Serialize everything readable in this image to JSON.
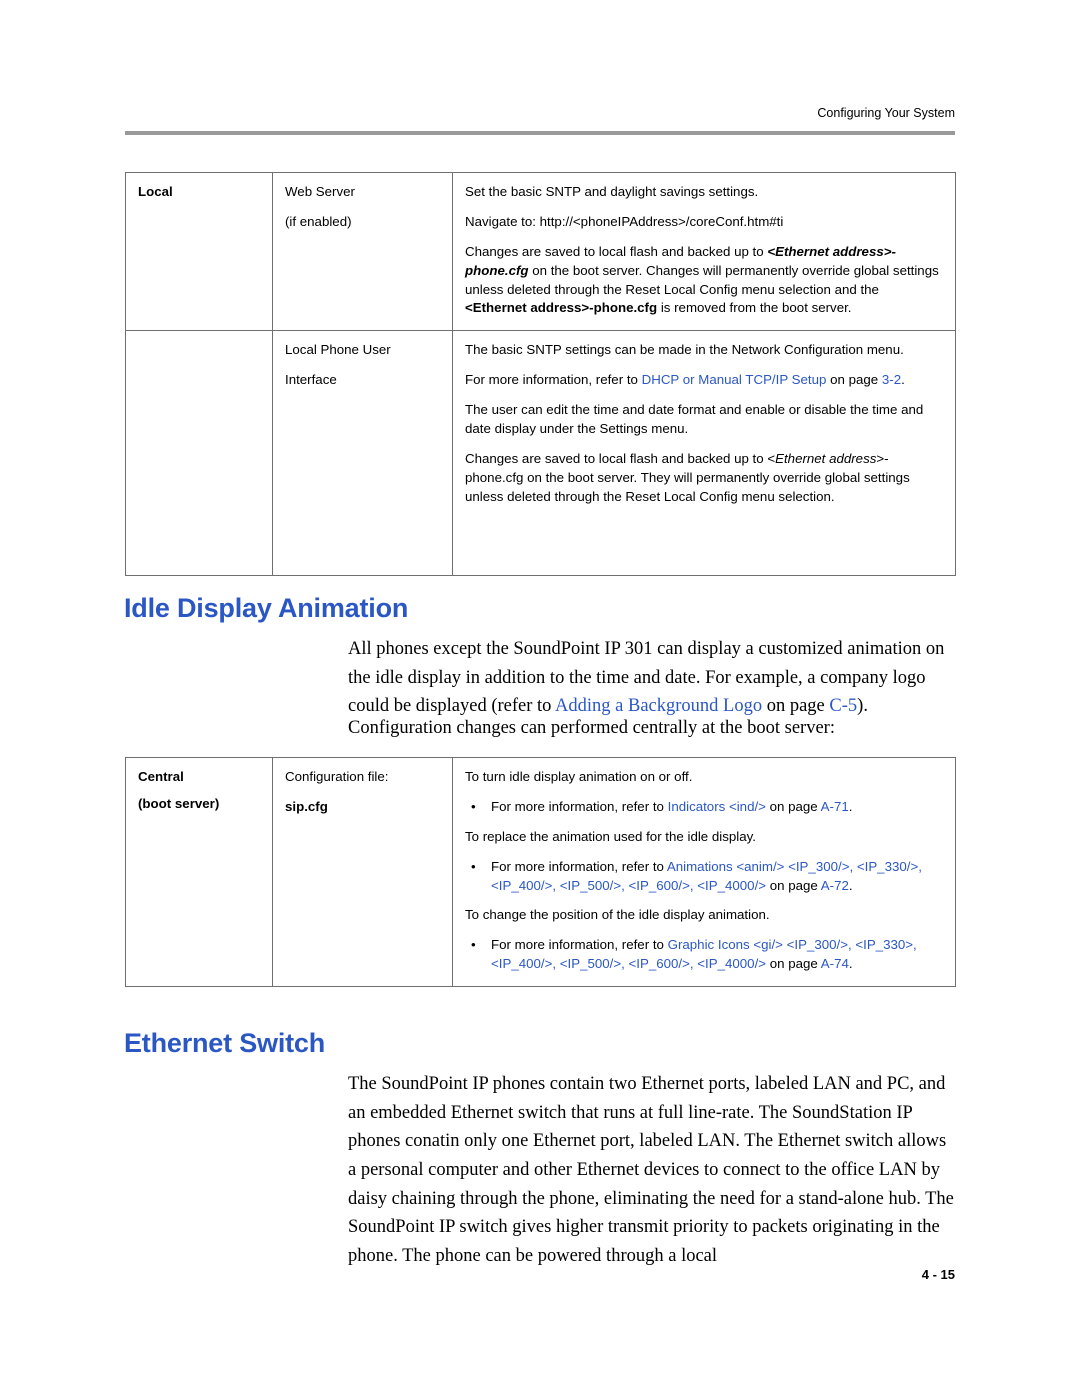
{
  "header": {
    "running_head": "Configuring Your System",
    "page_number": "4 - 15"
  },
  "table1": {
    "row1": {
      "col1": "Local",
      "col2_line1": "Web Server",
      "col2_line2": "(if enabled)",
      "p1": "Set the basic SNTP and daylight savings settings.",
      "p2": "Navigate to:  http://<phoneIPAddress>/coreConf.htm#ti",
      "p3_a": "Changes are saved to local flash and backed up to ",
      "p3_b": "<Ethernet address>-phone.cfg",
      "p3_c": " on the boot server. Changes will permanently override global settings unless deleted through the Reset Local Config menu selection and the ",
      "p3_d": "<Ethernet address>-phone.cfg",
      "p3_e": " is removed from the boot server."
    },
    "row2": {
      "col2_line1": "Local Phone User",
      "col2_line2": "Interface",
      "p1": "The basic SNTP settings can be made in the Network Configuration menu.",
      "p2_a": "For more information, refer to ",
      "p2_link": "DHCP or Manual TCP/IP Setup",
      "p2_b": " on page ",
      "p2_ref": "3-2",
      "p2_c": ".",
      "p3": "The user can edit the time and date format and enable or disable the time and date display under the Settings menu.",
      "p4_a": "Changes are saved to local flash and backed up to <",
      "p4_ital": "Ethernet address",
      "p4_b": ">-phone.cfg on the boot server. They will permanently override global settings unless deleted through the Reset Local Config menu selection."
    }
  },
  "section1": {
    "heading": "Idle Display Animation",
    "para1_a": "All phones except the SoundPoint IP 301 can display a customized animation on the idle display in addition to the time and date. For example, a company logo could be displayed (refer to ",
    "para1_link": "Adding a Background Logo",
    "para1_b": " on page ",
    "para1_ref": "C-5",
    "para1_c": ").",
    "para2": "Configuration changes can performed centrally at the boot server:"
  },
  "table2": {
    "col1_line1": "Central",
    "col1_line2": "(boot server)",
    "col2_line1": "Configuration file:",
    "col2_line2": "sip.cfg",
    "p1": "To turn idle display animation on or off.",
    "b1_a": "For more information, refer to ",
    "b1_link": "Indicators <ind/>",
    "b1_b": " on page ",
    "b1_ref": "A-71",
    "b1_c": ".",
    "p2": "To replace the animation used for the idle display.",
    "b2_a": "For more information, refer to ",
    "b2_link": "Animations <anim/> <IP_300/>, <IP_330/>, <IP_400/>, <IP_500/>, <IP_600/>, <IP_4000/>",
    "b2_b": " on page ",
    "b2_ref": "A-72",
    "b2_c": ".",
    "p3": "To change the position of the idle display animation.",
    "b3_a": "For more information, refer to ",
    "b3_link": "Graphic Icons <gi/> <IP_300/>, <IP_330>, <IP_400/>, <IP_500/>, <IP_600/>, <IP_4000/>",
    "b3_b": " on page ",
    "b3_ref": "A-74",
    "b3_c": "."
  },
  "section2": {
    "heading": "Ethernet Switch",
    "para1": "The SoundPoint IP phones contain two Ethernet ports, labeled LAN and PC, and an embedded Ethernet switch that runs at full line-rate. The SoundStation IP phones conatin only one Ethernet port, labeled LAN. The Ethernet switch allows a personal computer and other Ethernet devices to connect to the office LAN by daisy chaining through the phone, eliminating the need for a stand-alone hub. The SoundPoint IP switch gives higher transmit priority to packets originating in the phone. The phone can be powered through a local"
  }
}
